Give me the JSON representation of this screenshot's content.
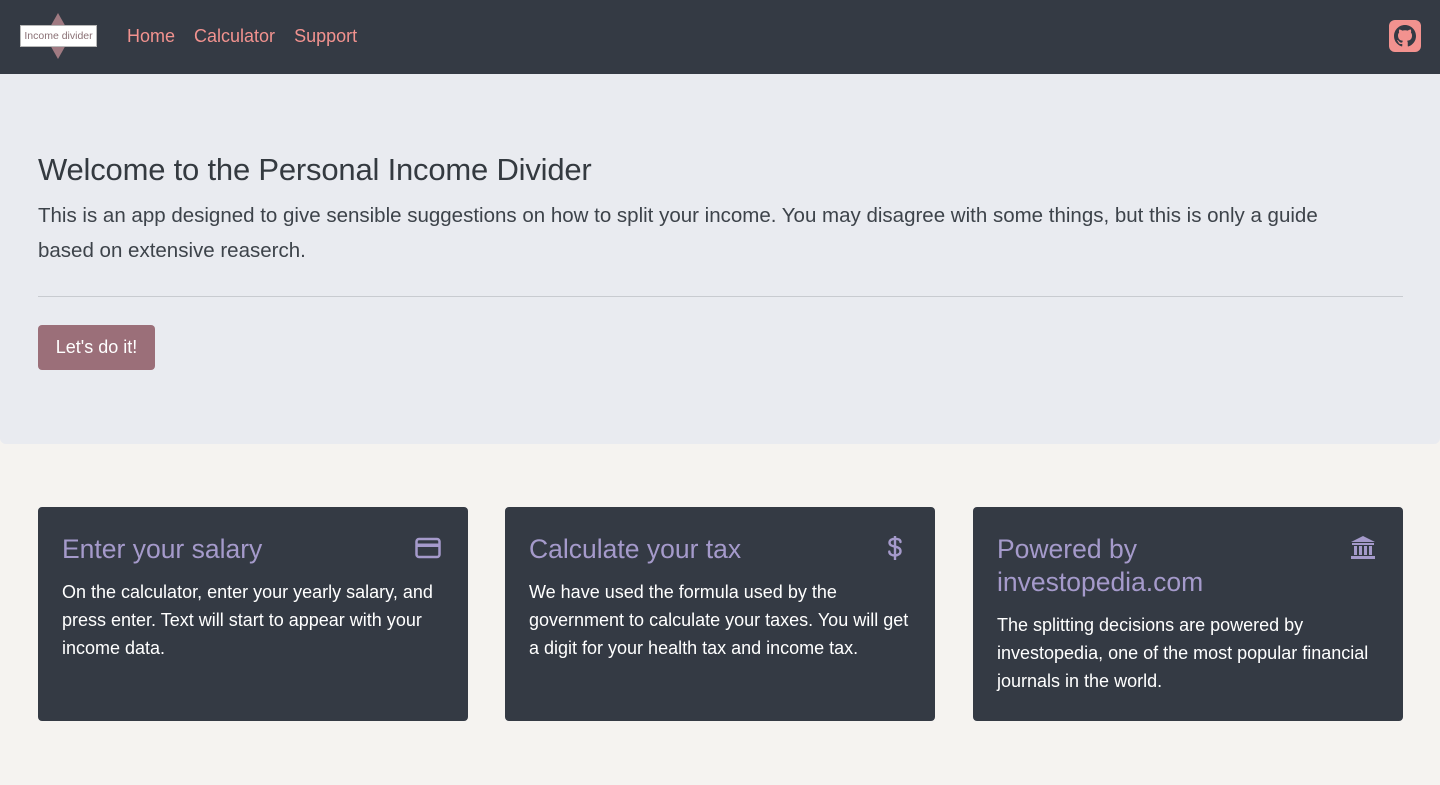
{
  "navbar": {
    "brand_label": "Income divider",
    "links": [
      {
        "label": "Home"
      },
      {
        "label": "Calculator"
      },
      {
        "label": "Support"
      }
    ],
    "github_icon": "github-icon"
  },
  "hero": {
    "title": "Welcome to the Personal Income Divider",
    "lead": "This is an app designed to give sensible suggestions on how to split your income. You may disagree with some things, but this is only a guide based on extensive reaserch.",
    "button_label": "Let's do it!"
  },
  "cards": [
    {
      "title": "Enter your salary",
      "text": "On the calculator, enter your yearly salary, and press enter. Text will start to appear with your income data.",
      "icon": "credit-card-icon"
    },
    {
      "title": "Calculate your tax",
      "text": "We have used the formula used by the government to calculate your taxes. You will get a digit for your health tax and income tax.",
      "icon": "dollar-icon"
    },
    {
      "title": "Powered by investopedia.com",
      "text": "The splitting decisions are powered by investopedia, one of the most popular financial journals in the world.",
      "icon": "bank-icon"
    }
  ],
  "colors": {
    "navbar_bg": "#343a44",
    "nav_link": "#f2928f",
    "hero_bg": "#e9ebf0",
    "button": "#9b6f79",
    "card_bg": "#343a44",
    "card_title": "#a59acb"
  }
}
